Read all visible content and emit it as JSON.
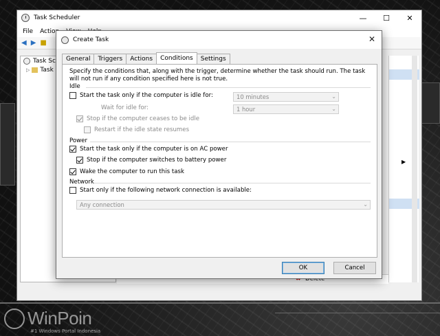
{
  "main_window": {
    "title": "Task Scheduler",
    "menu": [
      "File",
      "Action",
      "View",
      "Help"
    ],
    "tree": [
      {
        "label": "Task Scheduler (Local)"
      },
      {
        "label": "Task Scheduler Library"
      }
    ],
    "partial_action_label": "Delete"
  },
  "dialog": {
    "title": "Create Task",
    "close_glyph": "✕",
    "tabs": [
      "General",
      "Triggers",
      "Actions",
      "Conditions",
      "Settings"
    ],
    "active_tab": "Conditions",
    "description": "Specify the conditions that, along with the trigger, determine whether the task should run.  The task will not run  if any condition specified here is not true.",
    "idle": {
      "title": "Idle",
      "start_if_idle": {
        "label": "Start the task only if the computer is idle for:",
        "checked": false
      },
      "idle_for_value": "10 minutes",
      "wait_label": "Wait for idle for:",
      "wait_value": "1 hour",
      "stop_if_not_idle": {
        "label": "Stop if the computer ceases to be idle",
        "checked": true,
        "enabled": false
      },
      "restart_if_idle": {
        "label": "Restart if the idle state resumes",
        "checked": false,
        "enabled": false
      }
    },
    "power": {
      "title": "Power",
      "ac_only": {
        "label": "Start the task only if the computer is on AC power",
        "checked": true
      },
      "stop_on_battery": {
        "label": "Stop if the computer switches to battery power",
        "checked": true
      },
      "wake": {
        "label": "Wake the computer to run this task",
        "checked": true
      }
    },
    "network": {
      "title": "Network",
      "start_if_network": {
        "label": "Start only if the following network connection is available:",
        "checked": false
      },
      "connection_value": "Any connection"
    },
    "buttons": {
      "ok": "OK",
      "cancel": "Cancel"
    }
  },
  "watermark": {
    "brand": "WinPoin",
    "tagline": "#1 Windows Portal Indonesia"
  }
}
